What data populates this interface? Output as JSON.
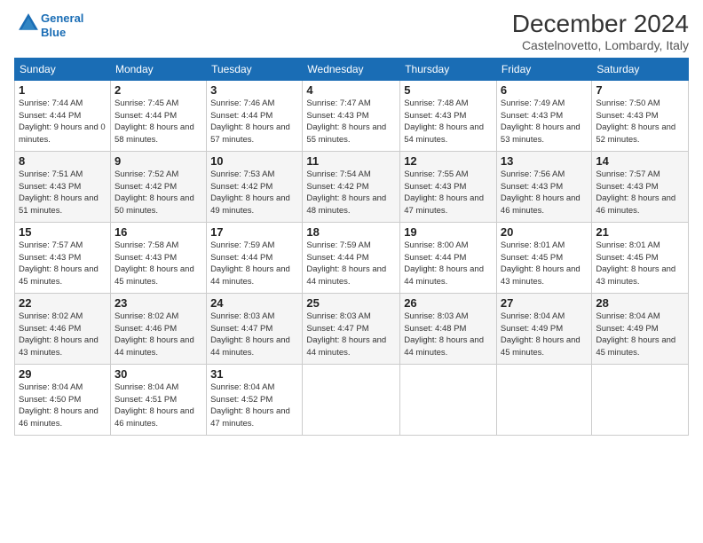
{
  "header": {
    "logo_line1": "General",
    "logo_line2": "Blue",
    "month_title": "December 2024",
    "location": "Castelnovetto, Lombardy, Italy"
  },
  "weekdays": [
    "Sunday",
    "Monday",
    "Tuesday",
    "Wednesday",
    "Thursday",
    "Friday",
    "Saturday"
  ],
  "weeks": [
    [
      {
        "day": "1",
        "sunrise": "7:44 AM",
        "sunset": "4:44 PM",
        "daylight": "9 hours and 0 minutes."
      },
      {
        "day": "2",
        "sunrise": "7:45 AM",
        "sunset": "4:44 PM",
        "daylight": "8 hours and 58 minutes."
      },
      {
        "day": "3",
        "sunrise": "7:46 AM",
        "sunset": "4:44 PM",
        "daylight": "8 hours and 57 minutes."
      },
      {
        "day": "4",
        "sunrise": "7:47 AM",
        "sunset": "4:43 PM",
        "daylight": "8 hours and 55 minutes."
      },
      {
        "day": "5",
        "sunrise": "7:48 AM",
        "sunset": "4:43 PM",
        "daylight": "8 hours and 54 minutes."
      },
      {
        "day": "6",
        "sunrise": "7:49 AM",
        "sunset": "4:43 PM",
        "daylight": "8 hours and 53 minutes."
      },
      {
        "day": "7",
        "sunrise": "7:50 AM",
        "sunset": "4:43 PM",
        "daylight": "8 hours and 52 minutes."
      }
    ],
    [
      {
        "day": "8",
        "sunrise": "7:51 AM",
        "sunset": "4:43 PM",
        "daylight": "8 hours and 51 minutes."
      },
      {
        "day": "9",
        "sunrise": "7:52 AM",
        "sunset": "4:42 PM",
        "daylight": "8 hours and 50 minutes."
      },
      {
        "day": "10",
        "sunrise": "7:53 AM",
        "sunset": "4:42 PM",
        "daylight": "8 hours and 49 minutes."
      },
      {
        "day": "11",
        "sunrise": "7:54 AM",
        "sunset": "4:42 PM",
        "daylight": "8 hours and 48 minutes."
      },
      {
        "day": "12",
        "sunrise": "7:55 AM",
        "sunset": "4:43 PM",
        "daylight": "8 hours and 47 minutes."
      },
      {
        "day": "13",
        "sunrise": "7:56 AM",
        "sunset": "4:43 PM",
        "daylight": "8 hours and 46 minutes."
      },
      {
        "day": "14",
        "sunrise": "7:57 AM",
        "sunset": "4:43 PM",
        "daylight": "8 hours and 46 minutes."
      }
    ],
    [
      {
        "day": "15",
        "sunrise": "7:57 AM",
        "sunset": "4:43 PM",
        "daylight": "8 hours and 45 minutes."
      },
      {
        "day": "16",
        "sunrise": "7:58 AM",
        "sunset": "4:43 PM",
        "daylight": "8 hours and 45 minutes."
      },
      {
        "day": "17",
        "sunrise": "7:59 AM",
        "sunset": "4:44 PM",
        "daylight": "8 hours and 44 minutes."
      },
      {
        "day": "18",
        "sunrise": "7:59 AM",
        "sunset": "4:44 PM",
        "daylight": "8 hours and 44 minutes."
      },
      {
        "day": "19",
        "sunrise": "8:00 AM",
        "sunset": "4:44 PM",
        "daylight": "8 hours and 44 minutes."
      },
      {
        "day": "20",
        "sunrise": "8:01 AM",
        "sunset": "4:45 PM",
        "daylight": "8 hours and 43 minutes."
      },
      {
        "day": "21",
        "sunrise": "8:01 AM",
        "sunset": "4:45 PM",
        "daylight": "8 hours and 43 minutes."
      }
    ],
    [
      {
        "day": "22",
        "sunrise": "8:02 AM",
        "sunset": "4:46 PM",
        "daylight": "8 hours and 43 minutes."
      },
      {
        "day": "23",
        "sunrise": "8:02 AM",
        "sunset": "4:46 PM",
        "daylight": "8 hours and 44 minutes."
      },
      {
        "day": "24",
        "sunrise": "8:03 AM",
        "sunset": "4:47 PM",
        "daylight": "8 hours and 44 minutes."
      },
      {
        "day": "25",
        "sunrise": "8:03 AM",
        "sunset": "4:47 PM",
        "daylight": "8 hours and 44 minutes."
      },
      {
        "day": "26",
        "sunrise": "8:03 AM",
        "sunset": "4:48 PM",
        "daylight": "8 hours and 44 minutes."
      },
      {
        "day": "27",
        "sunrise": "8:04 AM",
        "sunset": "4:49 PM",
        "daylight": "8 hours and 45 minutes."
      },
      {
        "day": "28",
        "sunrise": "8:04 AM",
        "sunset": "4:49 PM",
        "daylight": "8 hours and 45 minutes."
      }
    ],
    [
      {
        "day": "29",
        "sunrise": "8:04 AM",
        "sunset": "4:50 PM",
        "daylight": "8 hours and 46 minutes."
      },
      {
        "day": "30",
        "sunrise": "8:04 AM",
        "sunset": "4:51 PM",
        "daylight": "8 hours and 46 minutes."
      },
      {
        "day": "31",
        "sunrise": "8:04 AM",
        "sunset": "4:52 PM",
        "daylight": "8 hours and 47 minutes."
      },
      null,
      null,
      null,
      null
    ]
  ]
}
